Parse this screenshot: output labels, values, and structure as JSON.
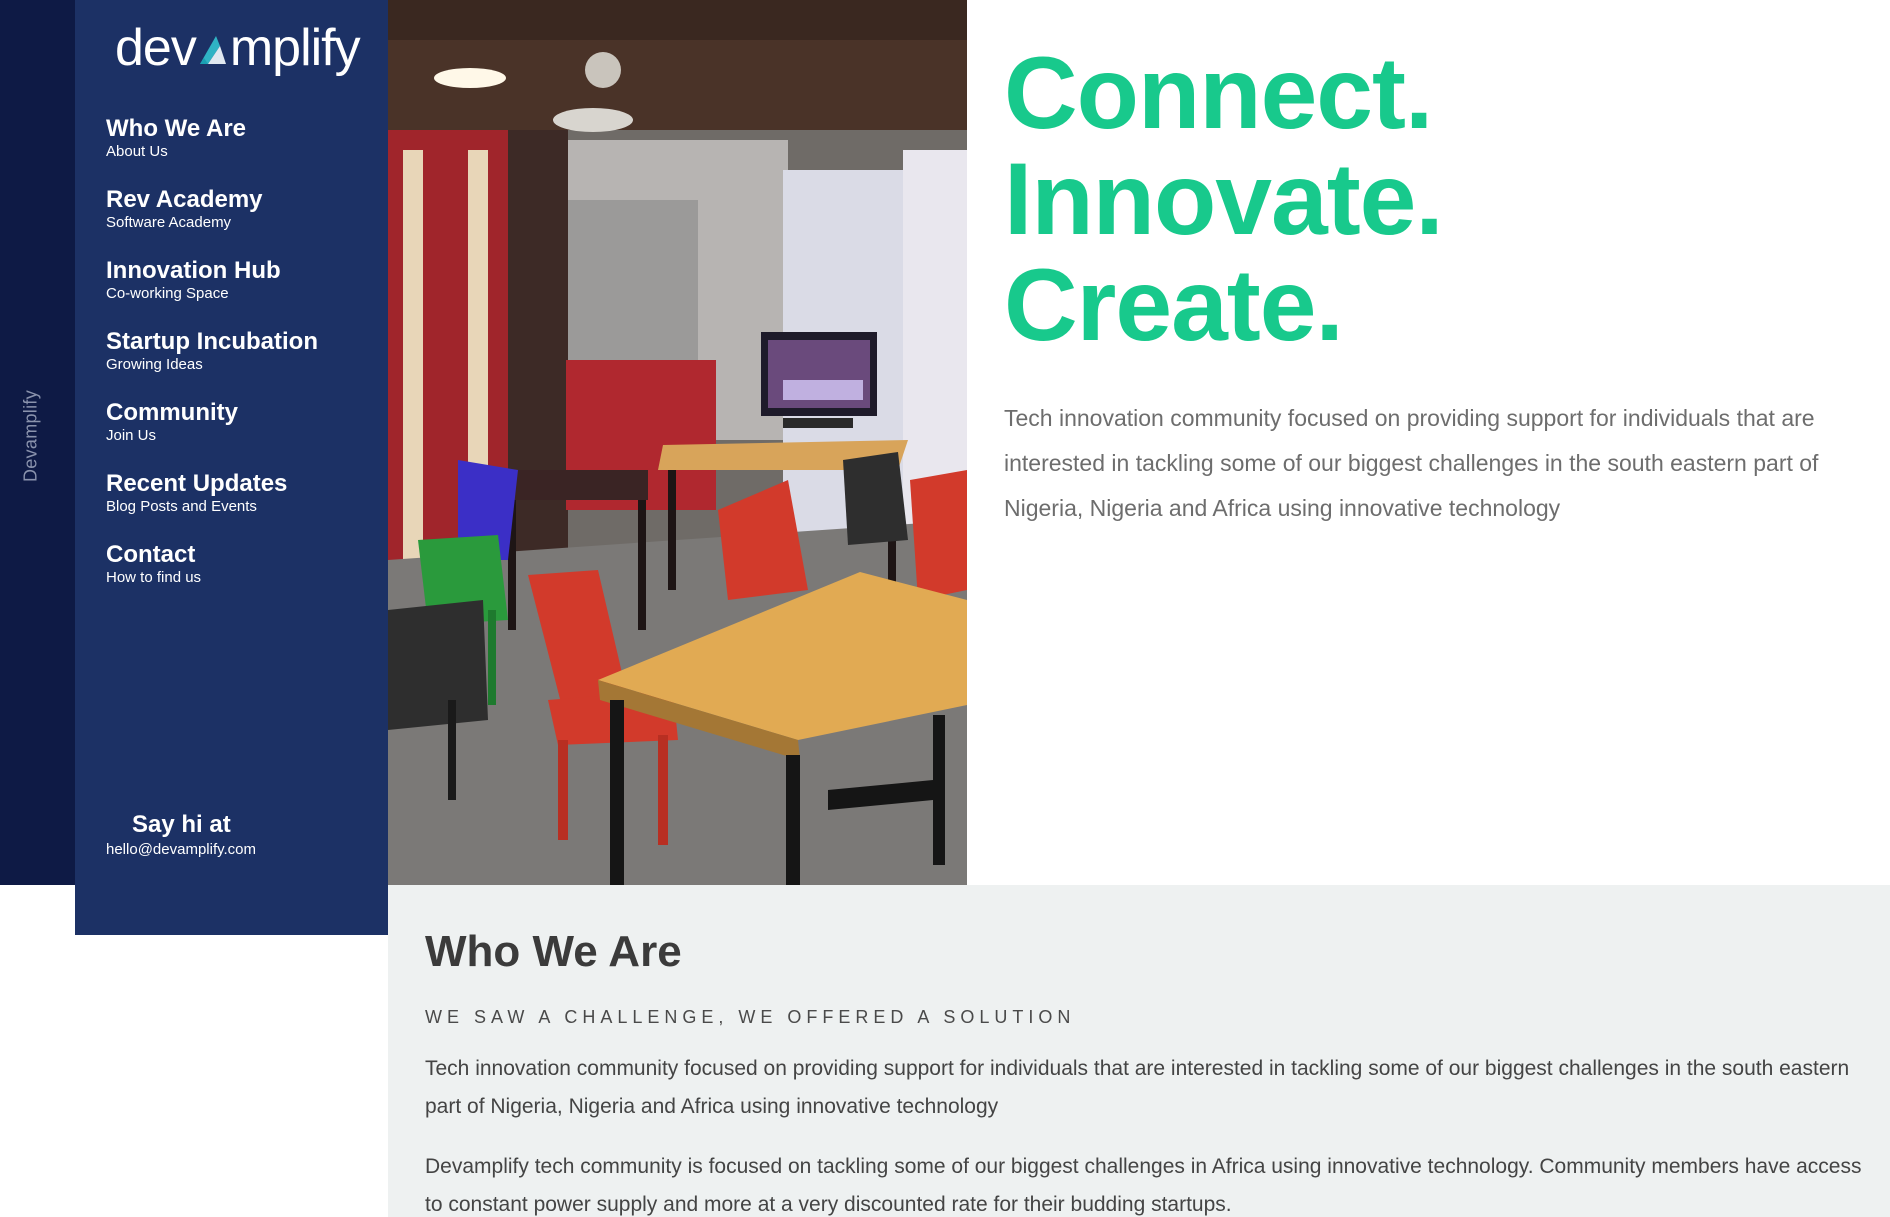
{
  "rail": {
    "label": "Devamplify"
  },
  "logo": {
    "text_before": "dev",
    "text_after": "mplify"
  },
  "nav": {
    "items": [
      {
        "title": "Who We Are",
        "subtitle": "About Us"
      },
      {
        "title": "Rev Academy",
        "subtitle": "Software Academy"
      },
      {
        "title": "Innovation Hub",
        "subtitle": "Co-working Space"
      },
      {
        "title": "Startup Incubation",
        "subtitle": "Growing Ideas"
      },
      {
        "title": "Community",
        "subtitle": "Join Us"
      },
      {
        "title": "Recent Updates",
        "subtitle": "Blog Posts and Events"
      },
      {
        "title": "Contact",
        "subtitle": "How to find us"
      }
    ]
  },
  "contact": {
    "title": "Say hi at",
    "email": "hello@devamplify.com"
  },
  "hero": {
    "line1": "Connect.",
    "line2": "Innovate.",
    "line3": "Create.",
    "description": "Tech innovation community focused on providing support for individuals that are interested in tackling some of our biggest challenges in the south eastern part of Nigeria, Nigeria and Africa using innovative technology"
  },
  "about": {
    "title": "Who We Are",
    "kicker": "WE SAW A CHALLENGE, WE OFFERED A SOLUTION",
    "paragraph1": "Tech innovation community focused on providing support for individuals that are interested in tackling some of our biggest challenges in the south eastern part of Nigeria, Nigeria and Africa using innovative technology",
    "paragraph2": "Devamplify tech community is focused on tackling some of our biggest challenges in Africa using innovative technology. Community members have access to constant power supply and more at a very discounted rate for their budding startups."
  },
  "colors": {
    "rail": "#0e1a45",
    "sidebar": "#1c3165",
    "accent_green": "#18c98c",
    "section_bg": "#eef1f1"
  }
}
